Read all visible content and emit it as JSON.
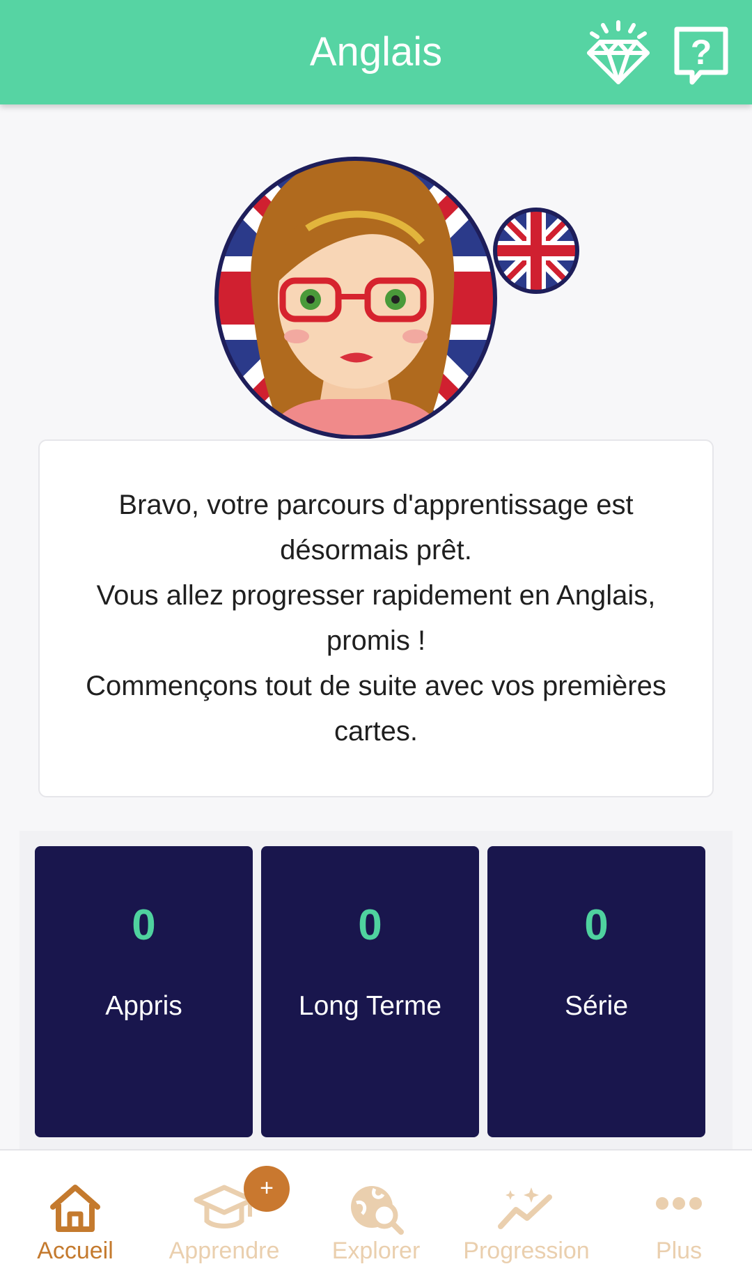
{
  "header": {
    "title": "Anglais",
    "icons": [
      "diamond-icon",
      "help-icon"
    ]
  },
  "avatar": {
    "icon": "teacher-avatar",
    "badge_icon": "uk-flag-icon"
  },
  "message": {
    "line1": "Bravo, votre parcours d'apprentissage est désormais prêt.",
    "line2": "Vous allez progresser rapidement en Anglais, promis !",
    "line3": "Commençons tout de suite avec vos premières cartes."
  },
  "stats": [
    {
      "value": "0",
      "label": "Appris"
    },
    {
      "value": "0",
      "label": "Long Terme"
    },
    {
      "value": "0",
      "label": "Série"
    }
  ],
  "nav": {
    "items": [
      {
        "label": "Accueil",
        "icon": "home-icon",
        "active": true
      },
      {
        "label": "Apprendre",
        "icon": "graduation-cap-icon",
        "active": false
      },
      {
        "label": "Explorer",
        "icon": "globe-search-icon",
        "active": false
      },
      {
        "label": "Progression",
        "icon": "progress-chart-icon",
        "active": false
      },
      {
        "label": "Plus",
        "icon": "more-dots-icon",
        "active": false
      }
    ],
    "badge": "+"
  },
  "colors": {
    "header": "#56d4a3",
    "stat_card": "#19164d",
    "stat_value": "#4fd29f",
    "nav_active": "#c47a2e",
    "nav_inactive": "#eacfae"
  }
}
